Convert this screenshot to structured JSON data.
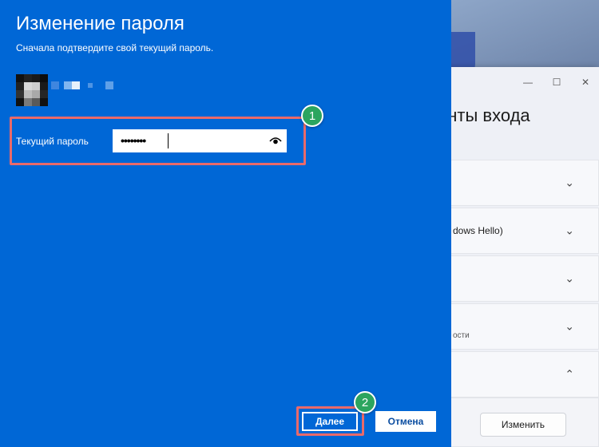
{
  "dialog": {
    "title": "Изменение пароля",
    "subtitle": "Сначала подтвердите свой текущий пароль.",
    "password_label": "Текущий пароль",
    "password_value": "••••••••",
    "next_label": "Далее",
    "cancel_label": "Отмена",
    "accent": "#0067d6"
  },
  "badges": {
    "first": "1",
    "second": "2"
  },
  "highlight_color": "#e96a6a",
  "settings": {
    "title": "анты входа",
    "window_controls": [
      "—",
      "☐",
      "✕"
    ],
    "cards": [
      {
        "text": ""
      },
      {
        "text": "dows Hello)"
      },
      {
        "text": ""
      },
      {
        "text": "ости"
      },
      {
        "text": ""
      }
    ],
    "change_button": "Изменить"
  }
}
